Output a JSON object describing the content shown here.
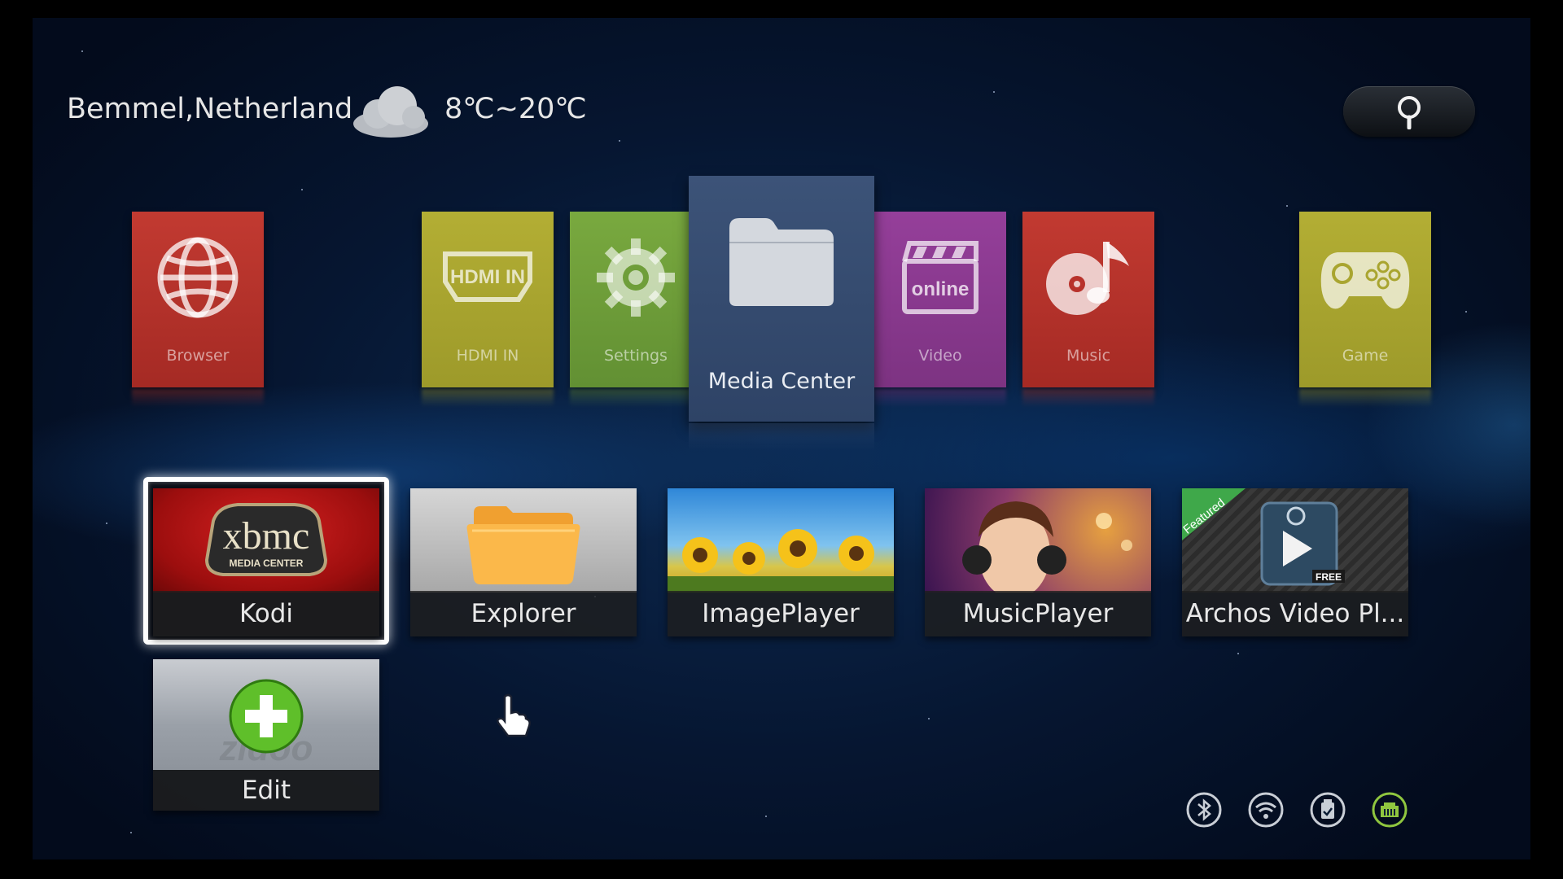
{
  "header": {
    "location": "Bemmel,Netherland",
    "temperature": "8℃~20℃",
    "weather_icon": "cloud-icon",
    "search_icon": "search-icon"
  },
  "top_tiles": [
    {
      "label": "Browser",
      "icon": "globe-icon",
      "color": "#b8322b"
    },
    {
      "label": "HDMI IN",
      "icon": "hdmi-icon",
      "color": "#a9a530"
    },
    {
      "label": "Settings",
      "icon": "gear-icon",
      "color": "#6f9e3a"
    },
    {
      "label": "Media Center",
      "icon": "folder-icon",
      "color": "#3c5378",
      "selected": true
    },
    {
      "label": "Video",
      "icon": "online-video-icon",
      "color": "#8d3c92"
    },
    {
      "label": "Music",
      "icon": "music-disc-icon",
      "color": "#b8322b"
    },
    {
      "label": "Game",
      "icon": "gamepad-icon",
      "color": "#a9a530"
    }
  ],
  "apps": [
    {
      "label": "Kodi",
      "logo_text": "xbmc",
      "logo_sub": "MEDIA CENTER",
      "focused": true
    },
    {
      "label": "Explorer"
    },
    {
      "label": "ImagePlayer"
    },
    {
      "label": "MusicPlayer"
    },
    {
      "label": "Archos Video Pl...",
      "badge": "Featured",
      "badge_free": "FREE"
    }
  ],
  "edit": {
    "label": "Edit",
    "watermark": "zidoo"
  },
  "status_bar": [
    "bluetooth-icon",
    "wifi-icon",
    "usb-storage-icon",
    "ethernet-icon"
  ],
  "colors": {
    "ethernet_active": "#8fc63f",
    "status_inactive": "#c9ced6"
  }
}
